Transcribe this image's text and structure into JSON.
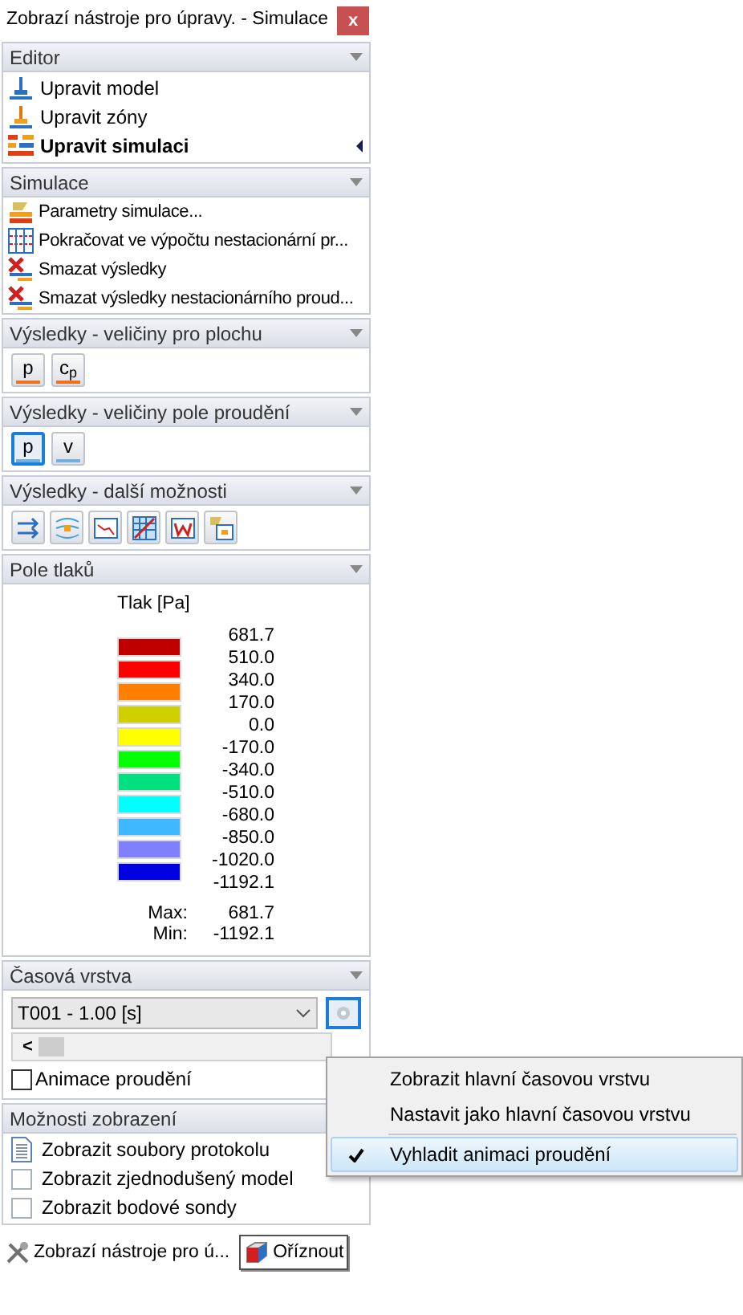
{
  "window": {
    "title": "Zobrazí nástroje pro úpravy. - Simulace",
    "close": "x"
  },
  "editor": {
    "title": "Editor",
    "items": [
      {
        "label": "Upravit model",
        "selected": false
      },
      {
        "label": "Upravit zóny",
        "selected": false
      },
      {
        "label": "Upravit simulaci",
        "selected": true
      }
    ]
  },
  "simulation": {
    "title": "Simulace",
    "items": [
      {
        "label": "Parametry simulace..."
      },
      {
        "label": "Pokračovat ve výpočtu nestacionární pr..."
      },
      {
        "label": "Smazat výsledky"
      },
      {
        "label": "Smazat výsledky nestacionárního proud..."
      }
    ]
  },
  "surface_results": {
    "title": "Výsledky - veličiny pro plochu",
    "buttons": [
      {
        "label": "p",
        "selected": false
      },
      {
        "label": "c$_{p}$",
        "selected": false
      }
    ]
  },
  "flow_results": {
    "title": "Výsledky - veličiny pole proudění",
    "buttons": [
      {
        "label": "p",
        "selected": true
      },
      {
        "label": "v",
        "selected": false
      }
    ]
  },
  "more_results": {
    "title": "Výsledky - další možnosti"
  },
  "pressure": {
    "title": "Pole tlaků",
    "legend_title": "Tlak [Pa]",
    "swatches": [
      {
        "color": "#c00000"
      },
      {
        "color": "#ff0000"
      },
      {
        "color": "#ff8000"
      },
      {
        "color": "#d0d000"
      },
      {
        "color": "#ffff00"
      },
      {
        "color": "#00ff00"
      },
      {
        "color": "#00e080"
      },
      {
        "color": "#00ffff"
      },
      {
        "color": "#40b8ff"
      },
      {
        "color": "#8080ff"
      },
      {
        "color": "#0000e0"
      }
    ],
    "values": [
      "681.7",
      "510.0",
      "340.0",
      "170.0",
      "0.0",
      "-170.0",
      "-340.0",
      "-510.0",
      "-680.0",
      "-850.0",
      "-1020.0",
      "-1192.1"
    ],
    "max_label": "Max:",
    "max_value": "681.7",
    "min_label": "Min:",
    "min_value": "-1192.1"
  },
  "time_layer": {
    "title": "Časová vrstva",
    "value": "T001 - 1.00 [s]",
    "scroll_left": "<",
    "animation": {
      "label": "Animace proudění",
      "checked": false
    }
  },
  "context_menu": {
    "items": [
      {
        "label": "Zobrazit hlavní časovou vrstvu",
        "checked": false
      },
      {
        "label": "Nastavit jako hlavní časovou vrstvu",
        "checked": false
      },
      {
        "label": "Vyhladit animaci proudění",
        "checked": true
      }
    ]
  },
  "display_options": {
    "title": "Možnosti zobrazení",
    "items": [
      {
        "label": "Zobrazit soubory protokolu",
        "kind": "document"
      },
      {
        "label": "Zobrazit zjednodušený model",
        "kind": "checkbox",
        "checked": false
      },
      {
        "label": "Zobrazit bodové sondy",
        "kind": "checkbox",
        "checked": false
      }
    ]
  },
  "bottom_tabs": [
    {
      "label": "Zobrazí nástroje pro ú...",
      "selected": false
    },
    {
      "label": "Oříznout",
      "selected": true
    }
  ]
}
